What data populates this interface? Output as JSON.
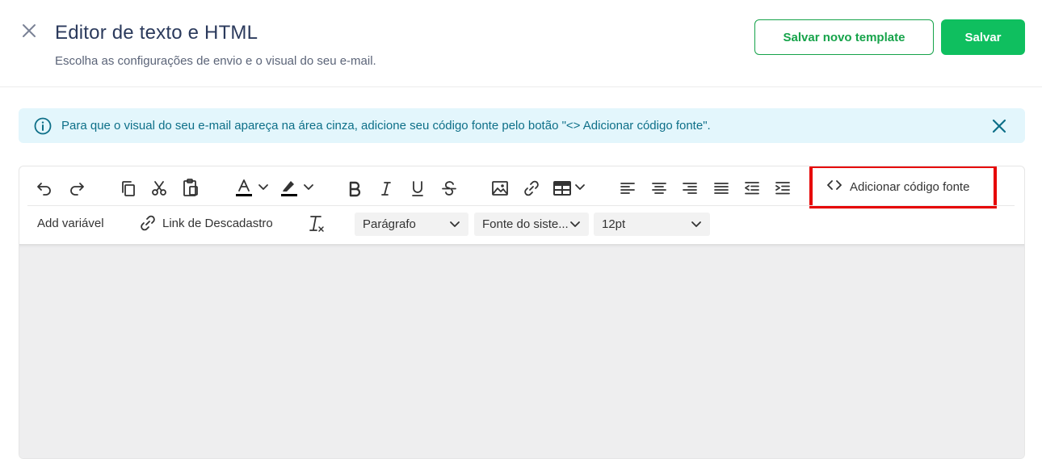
{
  "header": {
    "title": "Editor de texto e HTML",
    "subtitle": "Escolha as configurações de envio e o visual do seu e-mail.",
    "save_template_label": "Salvar novo template",
    "save_label": "Salvar"
  },
  "alert": {
    "text": "Para que o visual do seu e-mail apareça na área cinza, adicione seu código fonte pelo botão \"<> Adicionar código fonte\"."
  },
  "toolbar": {
    "add_source_label": "Adicionar código fonte",
    "add_variable_label": "Add variável",
    "unsubscribe_link_label": "Link de Descadastro",
    "block_format_value": "Parágrafo",
    "font_family_value": "Fonte do siste...",
    "font_size_value": "12pt"
  },
  "colors": {
    "brand_green": "#0fbf5f",
    "outline_green": "#16a34a",
    "info_bg": "#e3f6fc",
    "info_text": "#0d6f88",
    "highlight_red": "#e60000",
    "canvas_gray": "#eeeeef"
  }
}
